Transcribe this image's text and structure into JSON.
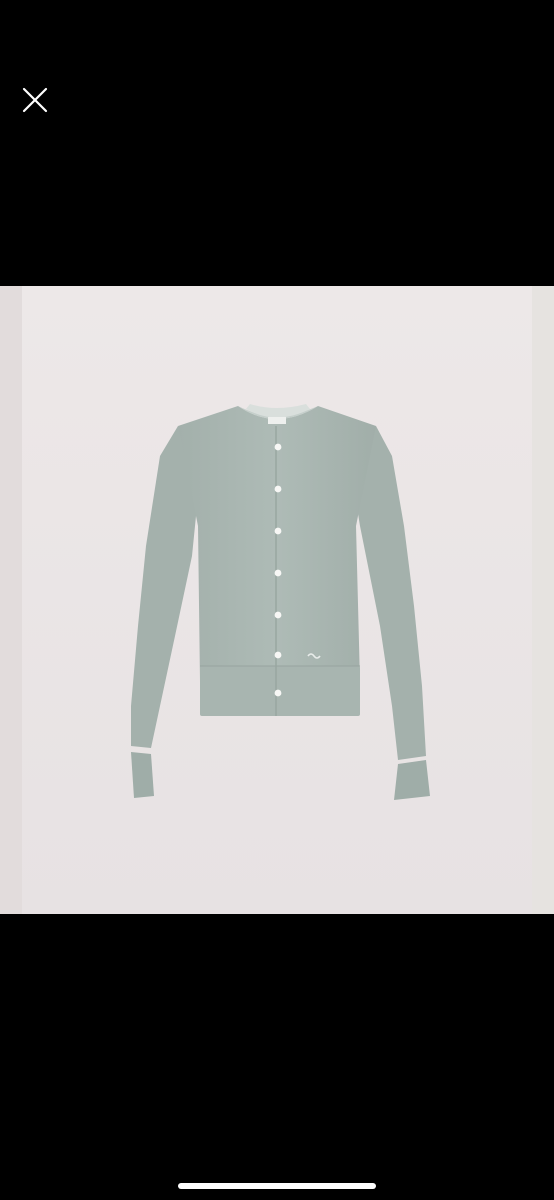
{
  "viewer": {
    "close_icon": "close-icon",
    "background_color": "#000000"
  },
  "photo": {
    "subject": "cardigan",
    "garment_color": "#a9b6b1",
    "backdrop_color": "#ebe6e6",
    "button_count": 7
  },
  "system": {
    "home_indicator_color": "#ffffff"
  }
}
